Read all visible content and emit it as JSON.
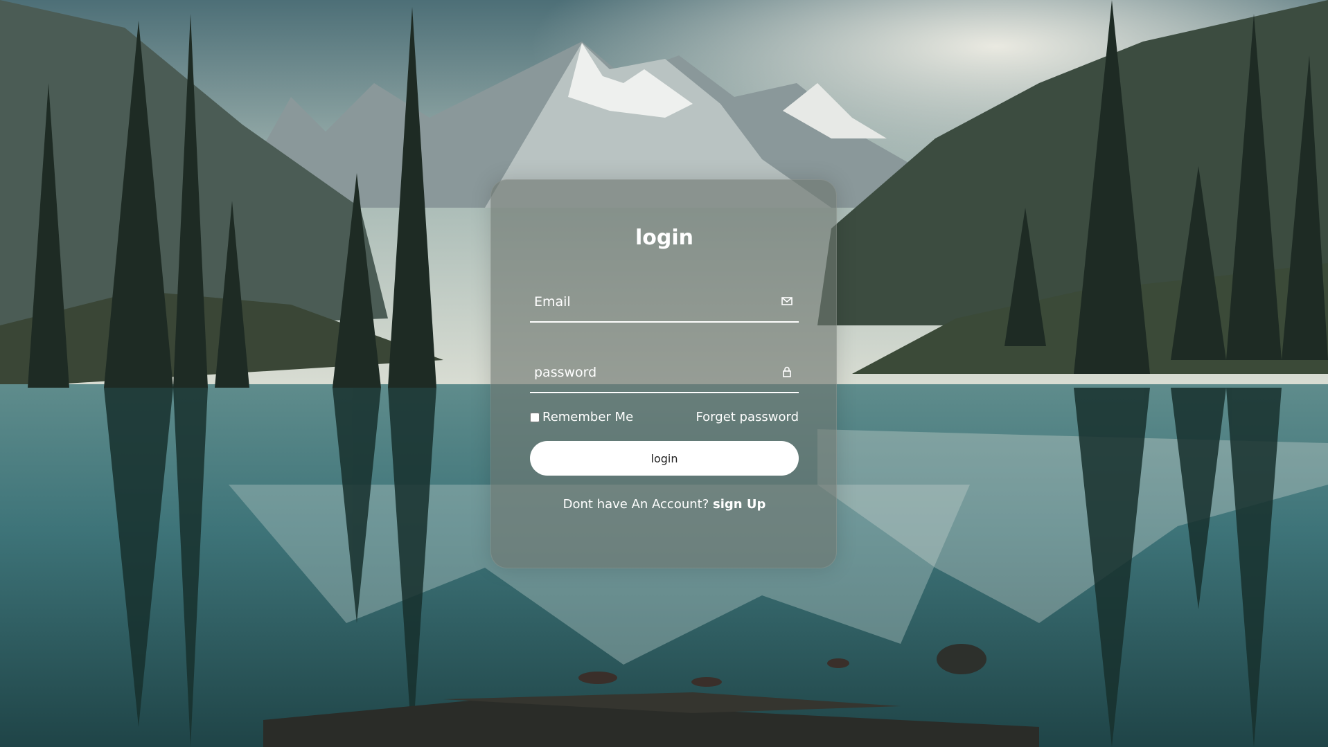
{
  "background": {
    "icon": "mountain-lake-landscape"
  },
  "login_form": {
    "title": "login",
    "email": {
      "placeholder": "Email",
      "icon": "envelope-icon"
    },
    "password": {
      "placeholder": "password",
      "icon": "lock-icon"
    },
    "remember_label": "Remember Me",
    "remember_checked": false,
    "forgot_label": "Forget password",
    "submit_label": "login",
    "signup_prompt": "Dont have An Account?",
    "signup_link": "sign Up"
  },
  "colors": {
    "card_tint": "#6e7670",
    "text": "#ffffff",
    "button_bg": "#ffffff",
    "button_text": "#222222"
  }
}
